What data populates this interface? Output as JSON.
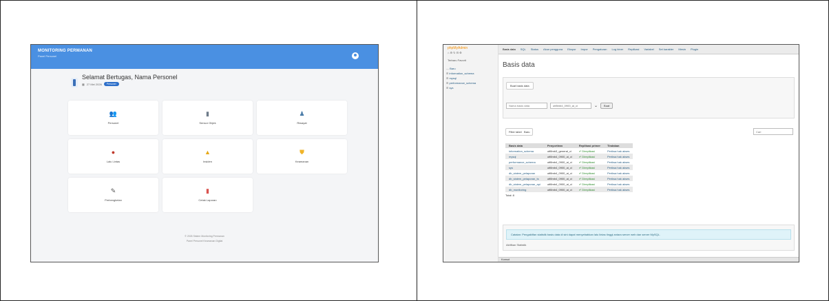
{
  "left": {
    "header_title": "MONITORING PERMANAN",
    "header_subtitle": "Panel Personel",
    "welcome_title": "Selamat Bertugas, Nama Personel",
    "welcome_date": "27 Mei 2026",
    "welcome_badge": "Personel",
    "cards": [
      {
        "label": "Personel",
        "icon": "people-icon",
        "color": "#5b2a82"
      },
      {
        "label": "Sensor Objek",
        "icon": "document-icon",
        "color": "#6e7c8a"
      },
      {
        "label": "Riwayat",
        "icon": "person-icon",
        "color": "#4a7ca8"
      },
      {
        "label": "Lalu Lintas",
        "icon": "car-icon",
        "color": "#c0392b"
      },
      {
        "label": "Insiden",
        "icon": "warning-icon",
        "color": "#e6a817"
      },
      {
        "label": "Keamanan",
        "icon": "shield-icon",
        "color": "#f0b429"
      },
      {
        "label": "Perbengkelan",
        "icon": "tool-icon",
        "color": "#555555"
      },
      {
        "label": "Cetak Laporan",
        "icon": "file-icon",
        "color": "#d9534f"
      }
    ],
    "footer_line1": "© 2026 Sistem Monitoring Permanan",
    "footer_line2": "Panel Personel Keamanan Digital"
  },
  "right": {
    "logo": "phpMyAdmin",
    "logo_icons": "⌂ ⚙ ↻ ⊟ ⚙",
    "recent": "Terbaru  Favorit",
    "tree": [
      "Baru",
      "information_schema",
      "mysql",
      "performance_schema",
      "sys"
    ],
    "nav": [
      "Basis data",
      "SQL",
      "Status",
      "Akun pengguna",
      "Ekspor",
      "Impor",
      "Pengaturan",
      "Log biner",
      "Replikasi",
      "Variabel",
      "Set karakter",
      "Mesin",
      "Plugin"
    ],
    "title": "Basis data",
    "create_tab": "Buat basis data",
    "create_name_placeholder": "Nama basis data",
    "create_collation": "utf8mb4_0900_ai_ci",
    "create_button": "Buat",
    "filter_tab1": "Filter tabel",
    "filter_tab2": "Baru",
    "filter_placeholder": "Cari",
    "table_headers": [
      "Basis data",
      "Penyortiran",
      "Replikasi primer",
      "Tindakan"
    ],
    "table_rows": [
      {
        "name": "information_schema",
        "collation": "utf8mb3_general_ci",
        "repl": "✔ Direplikasi",
        "action": "Periksa hak akses"
      },
      {
        "name": "mysql",
        "collation": "utf8mb4_0900_ai_ci",
        "repl": "✔ Direplikasi",
        "action": "Periksa hak akses"
      },
      {
        "name": "performance_schema",
        "collation": "utf8mb4_0900_ai_ci",
        "repl": "✔ Direplikasi",
        "action": "Periksa hak akses"
      },
      {
        "name": "sys",
        "collation": "utf8mb4_0900_ai_ci",
        "repl": "✔ Direplikasi",
        "action": "Periksa hak akses"
      },
      {
        "name": "db_sistem_pelaporan",
        "collation": "utf8mb4_0900_ai_ci",
        "repl": "✔ Direplikasi",
        "action": "Periksa hak akses"
      },
      {
        "name": "db_sistem_pelaporan_ts",
        "collation": "utf8mb4_0900_ai_ci",
        "repl": "✔ Direplikasi",
        "action": "Periksa hak akses"
      },
      {
        "name": "db_sistem_pelaporan_api",
        "collation": "utf8mb4_0900_ai_ci",
        "repl": "✔ Direplikasi",
        "action": "Periksa hak akses"
      },
      {
        "name": "db_monitoring",
        "collation": "utf8mb4_0900_ai_ci",
        "repl": "✔ Direplikasi",
        "action": "Periksa hak akses"
      }
    ],
    "total": "Total: 8",
    "notice": "Catatan: Pengaktifan statistik basis data di sini dapat menyebabkan lalu lintas tinggi antara server web dan server MySQL.",
    "enable_stats": "Aktifkan Statistik",
    "console": "Konsol"
  }
}
